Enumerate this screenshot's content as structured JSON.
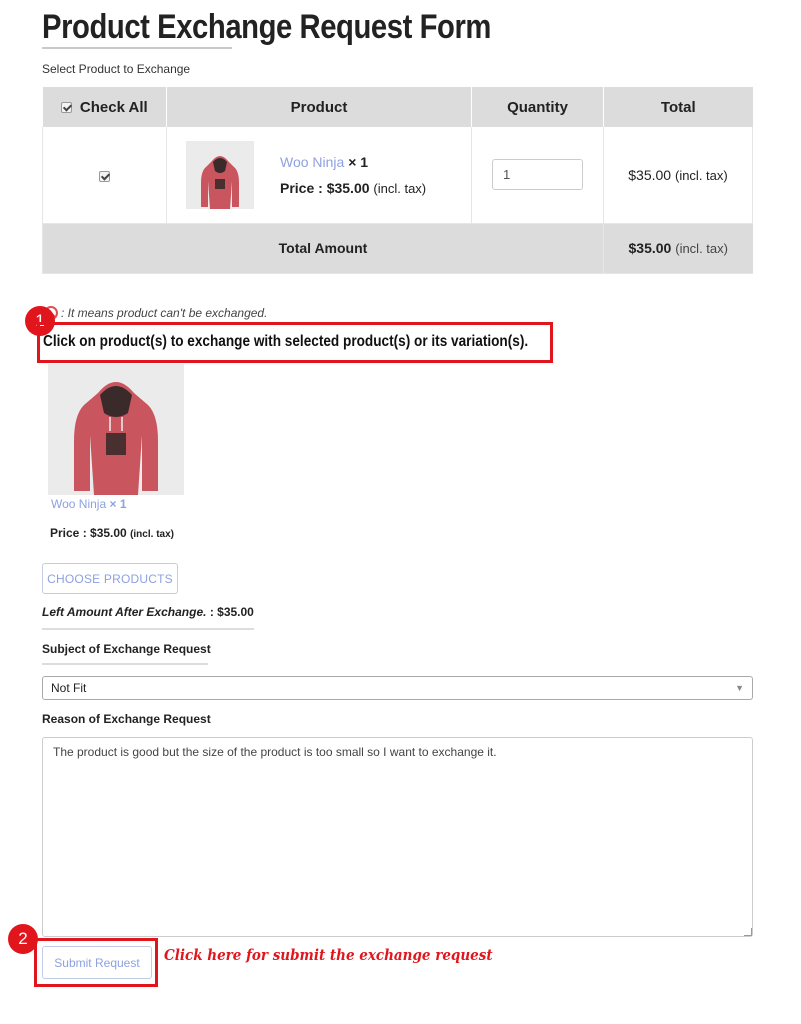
{
  "page": {
    "title": "Product Exchange Request Form",
    "subtitle": "Select Product to Exchange"
  },
  "table": {
    "headers": {
      "check_all": "Check All",
      "product": "Product",
      "quantity": "Quantity",
      "total": "Total"
    },
    "row": {
      "product_name": "Woo Ninja",
      "multiplier": "× 1",
      "price_label": "Price : $35.00",
      "price_tax": "(incl. tax)",
      "quantity": "1",
      "total": "$35.00",
      "total_tax": "(incl. tax)"
    },
    "footer": {
      "label": "Total Amount",
      "amount": "$35.00",
      "amount_tax": "(incl. tax)"
    }
  },
  "note": {
    "icon": "ban-icon",
    "text": ": It means product can't be exchanged."
  },
  "instruction": {
    "badge": "1",
    "text": "Click on product(s) to exchange with selected product(s) or its variation(s)."
  },
  "exchange_product": {
    "name": "Woo Ninja",
    "multiplier": "× 1",
    "price_label": "Price : $35.00",
    "price_tax": "(incl. tax)"
  },
  "choose_button": "CHOOSE PRODUCTS",
  "left_amount": {
    "label": "Left Amount After Exchange.",
    "value": ": $35.00"
  },
  "subject": {
    "label": "Subject of Exchange Request",
    "selected": "Not Fit"
  },
  "reason": {
    "label": "Reason of Exchange Request",
    "text": "The product is good but the size of the product is too small so I want to exchange it."
  },
  "submit": {
    "badge": "2",
    "label": "Submit Request",
    "hint": "Click here for submit the exchange request"
  },
  "colors": {
    "accent_red": "#e1161d",
    "link_blue": "#8ea1e0",
    "header_gray": "#dcdcdc",
    "hoodie_red": "#c9555f"
  }
}
